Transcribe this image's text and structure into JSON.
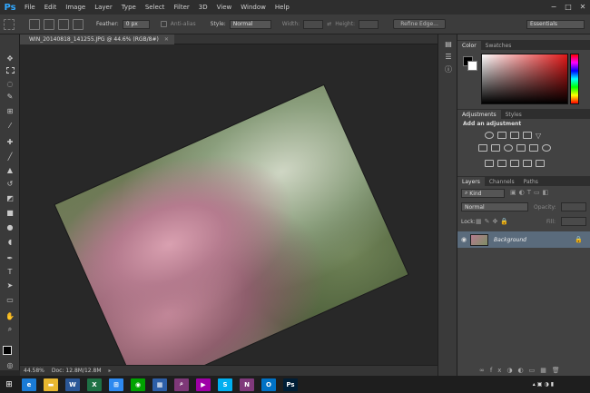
{
  "app": {
    "logo": "Ps"
  },
  "menu": [
    "File",
    "Edit",
    "Image",
    "Layer",
    "Type",
    "Select",
    "Filter",
    "3D",
    "View",
    "Window",
    "Help"
  ],
  "window_buttons": [
    "−",
    "□",
    "✕"
  ],
  "options": {
    "feather_label": "Feather:",
    "feather_value": "0 px",
    "antialias_label": "Anti-alias",
    "style_label": "Style:",
    "style_value": "Normal",
    "width_label": "Width:",
    "height_label": "Height:",
    "refine_edge": "Refine Edge...",
    "workspace": "Essentials"
  },
  "document": {
    "tab_title": "WIN_20140818_141255.JPG @ 44.6% (RGB/8#)"
  },
  "status": {
    "zoom": "44.58%",
    "doc": "Doc: 12.8M/12.8M"
  },
  "panels": {
    "color_tabs": [
      "Color",
      "Swatches"
    ],
    "adjustments_tabs": [
      "Adjustments",
      "Styles"
    ],
    "add_adjustment": "Add an adjustment",
    "layers_tabs": [
      "Layers",
      "Channels",
      "Paths"
    ],
    "kind_label": "Kind",
    "blend_mode": "Normal",
    "opacity_label": "Opacity:",
    "lock_label": "Lock:",
    "fill_label": "Fill:",
    "layer_name": "Background"
  },
  "taskbar": {
    "apps": [
      {
        "icon": "ie-icon",
        "glyph": "e",
        "color": "#1a7bd6"
      },
      {
        "icon": "folder-icon",
        "glyph": "▬",
        "color": "#e8b730"
      },
      {
        "icon": "word-icon",
        "glyph": "W",
        "color": "#2b5797"
      },
      {
        "icon": "excel-icon",
        "glyph": "X",
        "color": "#1e7145"
      },
      {
        "icon": "remote-icon",
        "glyph": "⊞",
        "color": "#2d89ef"
      },
      {
        "icon": "network-icon",
        "glyph": "◉",
        "color": "#00a300"
      },
      {
        "icon": "media-icon",
        "glyph": "▦",
        "color": "#2d5fa8"
      },
      {
        "icon": "search-icon",
        "glyph": "⌕",
        "color": "#7e3878"
      },
      {
        "icon": "video-icon",
        "glyph": "▶",
        "color": "#9f00a7"
      },
      {
        "icon": "skype-icon",
        "glyph": "S",
        "color": "#00aff0"
      },
      {
        "icon": "onenote-icon",
        "glyph": "N",
        "color": "#80397b"
      },
      {
        "icon": "outlook-icon",
        "glyph": "O",
        "color": "#0072c6"
      },
      {
        "icon": "photoshop-icon",
        "glyph": "Ps",
        "color": "#001e36"
      }
    ]
  }
}
